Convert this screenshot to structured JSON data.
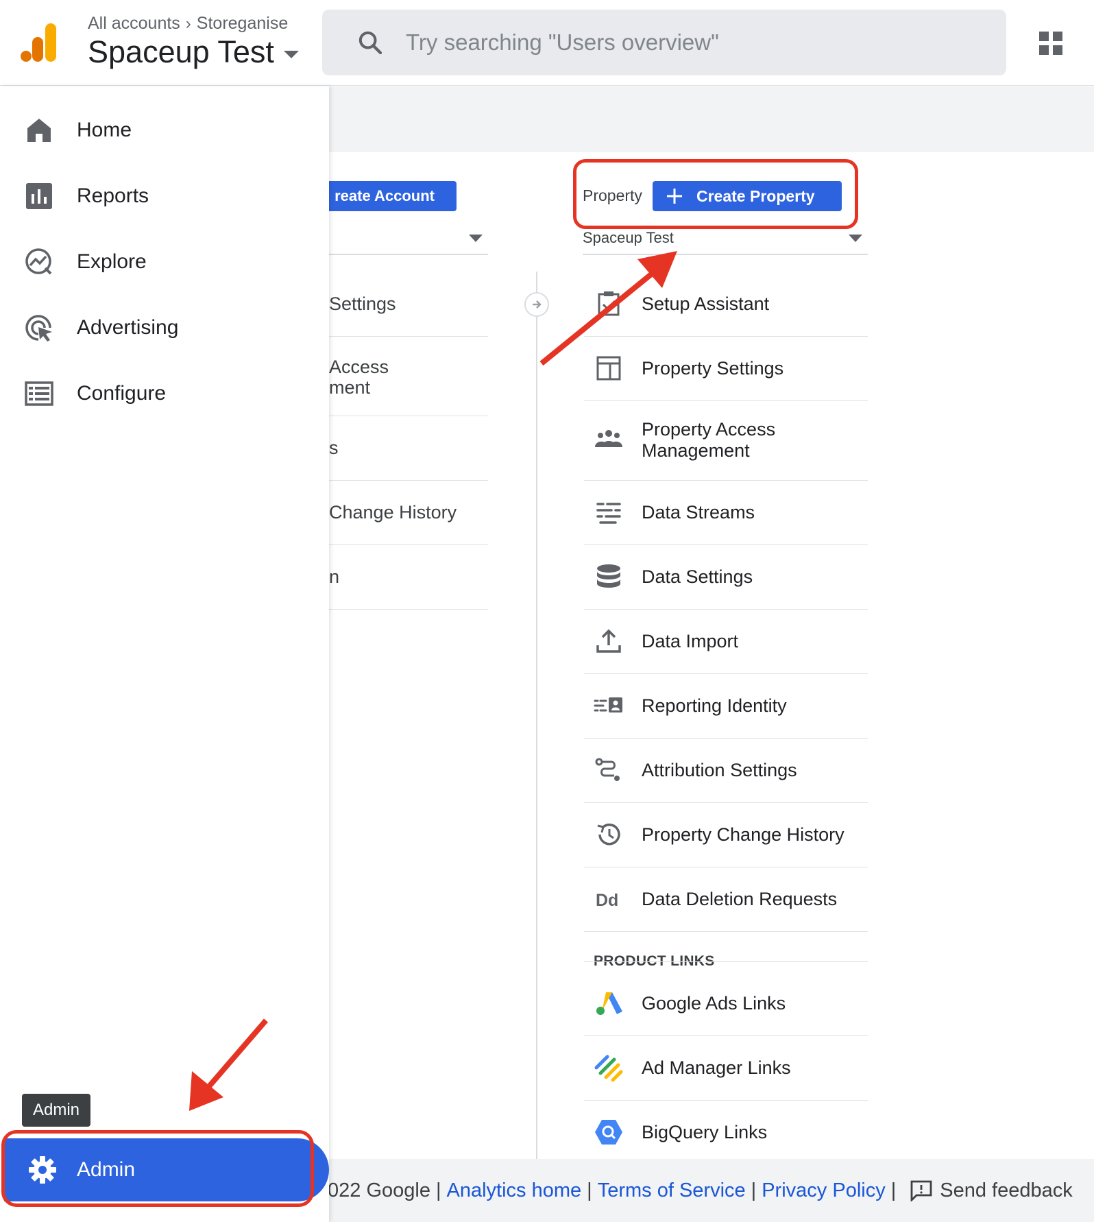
{
  "header": {
    "breadcrumb": [
      "All accounts",
      "Storeganise"
    ],
    "property_name": "Spaceup Test",
    "search_placeholder": "Try searching \"Users overview\""
  },
  "nav": {
    "items": [
      {
        "label": "Home",
        "icon": "home-icon"
      },
      {
        "label": "Reports",
        "icon": "bar-chart-icon"
      },
      {
        "label": "Explore",
        "icon": "explore-icon"
      },
      {
        "label": "Advertising",
        "icon": "advertising-icon"
      },
      {
        "label": "Configure",
        "icon": "list-icon"
      }
    ],
    "tooltip": "Admin",
    "admin_label": "Admin"
  },
  "account_column": {
    "create_label": "reate Account",
    "items": [
      "Settings",
      "Access",
      "ment",
      "s",
      "Change History",
      "n"
    ]
  },
  "property_column": {
    "label": "Property",
    "create_label": "Create Property",
    "selected": "Spaceup Test",
    "items": [
      {
        "label": "Setup Assistant",
        "icon": "clipboard-check-icon"
      },
      {
        "label": "Property Settings",
        "icon": "property-settings-icon"
      },
      {
        "label": "Property Access Management",
        "icon": "people-icon"
      },
      {
        "label": "Data Streams",
        "icon": "data-streams-icon"
      },
      {
        "label": "Data Settings",
        "icon": "database-icon"
      },
      {
        "label": "Data Import",
        "icon": "upload-icon"
      },
      {
        "label": "Reporting Identity",
        "icon": "reporting-identity-icon"
      },
      {
        "label": "Attribution Settings",
        "icon": "attribution-icon"
      },
      {
        "label": "Property Change History",
        "icon": "history-icon"
      },
      {
        "label": "Data Deletion Requests",
        "icon": "data-deletion-icon"
      }
    ],
    "product_links_heading": "PRODUCT LINKS",
    "product_links": [
      {
        "label": "Google Ads Links",
        "icon": "google-ads-icon"
      },
      {
        "label": "Ad Manager Links",
        "icon": "ad-manager-icon"
      },
      {
        "label": "BigQuery Links",
        "icon": "bigquery-icon"
      }
    ]
  },
  "footer": {
    "copyright": "022 Google",
    "links": [
      "Analytics home",
      "Terms of Service",
      "Privacy Policy"
    ],
    "feedback": "Send feedback"
  },
  "colors": {
    "accent": "#2e63e0",
    "annotation": "#e53423",
    "logo_orange": "#f9ab00",
    "logo_dark_orange": "#e37400"
  }
}
